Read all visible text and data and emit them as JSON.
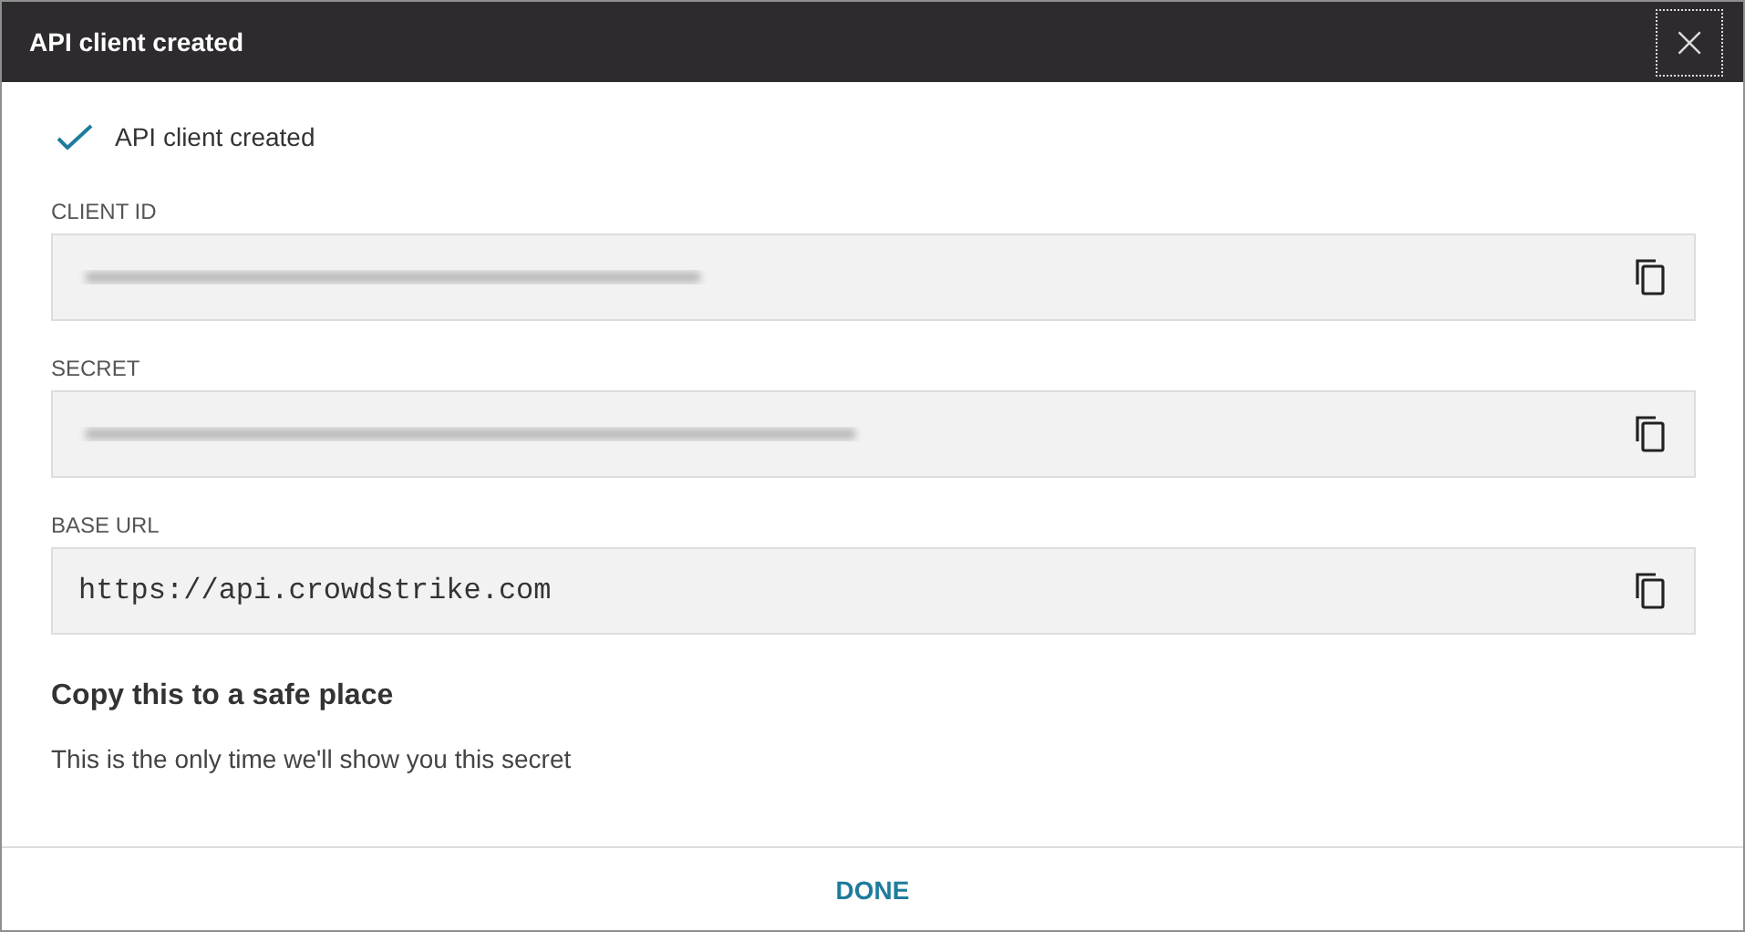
{
  "dialog": {
    "title": "API client created",
    "close_button": "×"
  },
  "status": {
    "message": "API client created"
  },
  "fields": [
    {
      "label": "CLIENT ID",
      "redacted": true
    },
    {
      "label": "SECRET",
      "redacted": true
    },
    {
      "label": "BASE URL",
      "redacted": false,
      "value": "https://api.crowdstrike.com"
    }
  ],
  "notice": {
    "heading": "Copy this to a safe place",
    "body": "This is the only time we'll show you this secret"
  },
  "buttons": [
    "DONE"
  ]
}
